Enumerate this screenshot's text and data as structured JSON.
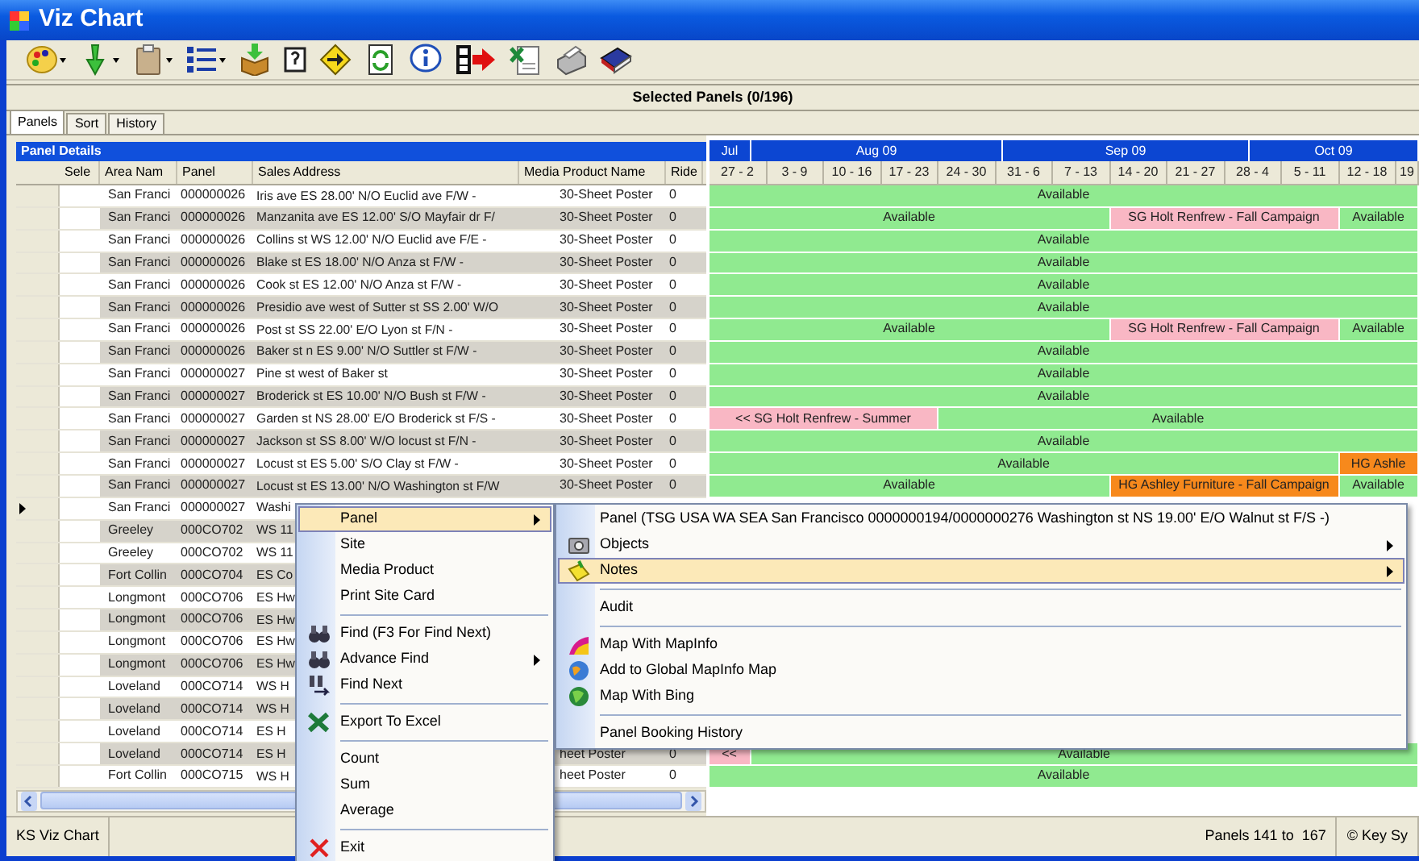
{
  "window": {
    "title": "Viz Chart"
  },
  "toolbar": [
    {
      "kind": "palette",
      "dropdown": true
    },
    {
      "kind": "arrow",
      "dropdown": true
    },
    {
      "kind": "clipboard",
      "dropdown": true
    },
    {
      "kind": "list",
      "dropdown": true
    },
    {
      "kind": "package",
      "dropdown": false
    },
    {
      "kind": "help",
      "dropdown": false
    },
    {
      "kind": "sign",
      "dropdown": false
    },
    {
      "kind": "refresh",
      "dropdown": false
    },
    {
      "kind": "info",
      "dropdown": false
    },
    {
      "kind": "film",
      "dropdown": false
    },
    {
      "kind": "spreadsheet",
      "dropdown": false
    },
    {
      "kind": "printer",
      "dropdown": false
    },
    {
      "kind": "book",
      "dropdown": false
    }
  ],
  "header": {
    "title": "Selected Panels (0/196)"
  },
  "tabs": [
    {
      "label": "Panels",
      "selected": true
    },
    {
      "label": "Sort",
      "selected": false
    },
    {
      "label": "History",
      "selected": false
    }
  ],
  "grid": {
    "title": "Panel Details",
    "columns": [
      "Sele",
      "Area Nam",
      "Panel",
      "Sales Address",
      "Media Product Name",
      "Ride"
    ],
    "rows": [
      {
        "current": false,
        "area": "San Franci",
        "panel": "000000026",
        "address": "Iris ave ES 28.00' N/O Euclid ave F/W -",
        "media": "30-Sheet Poster",
        "ride": "0"
      },
      {
        "current": false,
        "area": "San Franci",
        "panel": "000000026",
        "address": "Manzanita ave ES 12.00' S/O Mayfair dr F/",
        "media": "30-Sheet Poster",
        "ride": "0"
      },
      {
        "current": false,
        "area": "San Franci",
        "panel": "000000026",
        "address": "Collins st WS 12.00' N/O Euclid ave F/E -",
        "media": "30-Sheet Poster",
        "ride": "0"
      },
      {
        "current": false,
        "area": "San Franci",
        "panel": "000000026",
        "address": "Blake st ES 18.00' N/O Anza st F/W -",
        "media": "30-Sheet Poster",
        "ride": "0"
      },
      {
        "current": false,
        "area": "San Franci",
        "panel": "000000026",
        "address": "Cook st ES 12.00' N/O Anza st F/W -",
        "media": "30-Sheet Poster",
        "ride": "0"
      },
      {
        "current": false,
        "area": "San Franci",
        "panel": "000000026",
        "address": "Presidio ave west of Sutter st SS 2.00' W/O",
        "media": "30-Sheet Poster",
        "ride": "0"
      },
      {
        "current": false,
        "area": "San Franci",
        "panel": "000000026",
        "address": "Post st SS 22.00' E/O Lyon st F/N -",
        "media": "30-Sheet Poster",
        "ride": "0"
      },
      {
        "current": false,
        "area": "San Franci",
        "panel": "000000026",
        "address": "Baker st n ES 9.00' N/O Suttler st F/W -",
        "media": "30-Sheet Poster",
        "ride": "0"
      },
      {
        "current": false,
        "area": "San Franci",
        "panel": "000000027",
        "address": "Pine st west of Baker st",
        "media": "30-Sheet Poster",
        "ride": "0"
      },
      {
        "current": false,
        "area": "San Franci",
        "panel": "000000027",
        "address": "Broderick st ES 10.00' N/O Bush st F/W -",
        "media": "30-Sheet Poster",
        "ride": "0"
      },
      {
        "current": false,
        "area": "San Franci",
        "panel": "000000027",
        "address": "Garden st NS 28.00' E/O Broderick st F/S -",
        "media": "30-Sheet Poster",
        "ride": "0"
      },
      {
        "current": false,
        "area": "San Franci",
        "panel": "000000027",
        "address": "Jackson st SS 8.00' W/O locust st F/N -",
        "media": "30-Sheet Poster",
        "ride": "0"
      },
      {
        "current": false,
        "area": "San Franci",
        "panel": "000000027",
        "address": "Locust st ES 5.00' S/O Clay st F/W -",
        "media": "30-Sheet Poster",
        "ride": "0"
      },
      {
        "current": false,
        "area": "San Franci",
        "panel": "000000027",
        "address": "Locust st ES 13.00' N/O Washington st F/W",
        "media": "30-Sheet Poster",
        "ride": "0"
      },
      {
        "current": true,
        "area": "San Franci",
        "panel": "000000027",
        "address": "Washi"
      },
      {
        "current": false,
        "area": "Greeley",
        "panel": "000CO702",
        "address": "WS 11"
      },
      {
        "current": false,
        "area": "Greeley",
        "panel": "000CO702",
        "address": "WS 11"
      },
      {
        "current": false,
        "area": "Fort Collin",
        "panel": "000CO704",
        "address": "ES Co"
      },
      {
        "current": false,
        "area": "Longmont",
        "panel": "000CO706",
        "address": "ES Hw"
      },
      {
        "current": false,
        "area": "Longmont",
        "panel": "000CO706",
        "address": "ES Hw"
      },
      {
        "current": false,
        "area": "Longmont",
        "panel": "000CO706",
        "address": "ES Hw"
      },
      {
        "current": false,
        "area": "Longmont",
        "panel": "000CO706",
        "address": "ES Hw"
      },
      {
        "current": false,
        "area": "Loveland",
        "panel": "000CO714",
        "address": "WS H"
      },
      {
        "current": false,
        "area": "Loveland",
        "panel": "000CO714",
        "address": "WS H"
      },
      {
        "current": false,
        "area": "Loveland",
        "panel": "000CO714",
        "address": "ES H"
      },
      {
        "current": false,
        "area": "Loveland",
        "panel": "000CO714",
        "address": "ES H",
        "media": "heet Poster",
        "ride": "0"
      },
      {
        "current": false,
        "area": "Fort Collin",
        "panel": "000CO715",
        "address": "WS H",
        "media": "heet Poster",
        "ride": "0"
      }
    ]
  },
  "chart": {
    "months": [
      "Jul",
      "Aug 09",
      "Sep 09",
      "Oct 09"
    ],
    "weeks": [
      "27 - 2",
      "3 - 9",
      "10 - 16",
      "17 - 23",
      "24 - 30",
      "31 - 6",
      "7 - 13",
      "14 - 20",
      "21 - 27",
      "28 - 4",
      "5 - 11",
      "12 - 18",
      "19"
    ],
    "rows": [
      {
        "segments": [
          {
            "kind": "available",
            "label": "Available"
          }
        ]
      },
      {
        "segments": [
          {
            "kind": "available",
            "label": "Available"
          },
          {
            "kind": "hold",
            "label": "SG Holt Renfrew - Fall Campaign"
          },
          {
            "kind": "available",
            "label": "Available"
          }
        ]
      },
      {
        "segments": [
          {
            "kind": "available",
            "label": "Available"
          }
        ]
      },
      {
        "segments": [
          {
            "kind": "available",
            "label": "Available"
          }
        ]
      },
      {
        "segments": [
          {
            "kind": "available",
            "label": "Available"
          }
        ]
      },
      {
        "segments": [
          {
            "kind": "available",
            "label": "Available"
          }
        ]
      },
      {
        "segments": [
          {
            "kind": "available",
            "label": "Available"
          },
          {
            "kind": "hold",
            "label": "SG Holt Renfrew - Fall Campaign"
          },
          {
            "kind": "available",
            "label": "Available"
          }
        ]
      },
      {
        "segments": [
          {
            "kind": "available",
            "label": "Available"
          }
        ]
      },
      {
        "segments": [
          {
            "kind": "available",
            "label": "Available"
          }
        ]
      },
      {
        "segments": [
          {
            "kind": "available",
            "label": "Available"
          }
        ]
      },
      {
        "segments": [
          {
            "kind": "hold",
            "label": "<< SG Holt Renfrew - Summer"
          },
          {
            "kind": "available",
            "label": "Available"
          }
        ]
      },
      {
        "segments": [
          {
            "kind": "available",
            "label": "Available"
          }
        ]
      },
      {
        "segments": [
          {
            "kind": "available",
            "label": "Available"
          },
          {
            "kind": "booked",
            "label": "HG Ashle"
          }
        ]
      },
      {
        "segments": [
          {
            "kind": "available",
            "label": "Available"
          },
          {
            "kind": "booked",
            "label": "HG Ashley Furniture - Fall Campaign"
          },
          {
            "kind": "available",
            "label": "Available"
          }
        ]
      }
    ],
    "lower_rows": [
      {
        "segments": [
          {
            "kind": "hold",
            "label": "<<"
          },
          {
            "kind": "available",
            "label": "Available"
          }
        ]
      },
      {
        "segments": [
          {
            "kind": "available",
            "label": "Available"
          }
        ]
      }
    ]
  },
  "context_menu": [
    {
      "kind": "item",
      "label": "Panel",
      "selected": true,
      "submenu": true
    },
    {
      "kind": "item",
      "label": "Site",
      "selected": false,
      "submenu": false
    },
    {
      "kind": "item",
      "label": "Media Product",
      "selected": false,
      "submenu": false
    },
    {
      "kind": "item",
      "label": "Print Site Card",
      "selected": false,
      "submenu": false
    },
    {
      "kind": "separator"
    },
    {
      "kind": "item",
      "label": "Find (F3 For Find Next)",
      "selected": false,
      "submenu": false
    },
    {
      "kind": "item",
      "label": "Advance Find",
      "selected": false,
      "submenu": true
    },
    {
      "kind": "item",
      "label": "Find Next",
      "selected": false,
      "submenu": false
    },
    {
      "kind": "separator"
    },
    {
      "kind": "item",
      "label": "Export To Excel",
      "selected": false,
      "submenu": false
    },
    {
      "kind": "separator"
    },
    {
      "kind": "item",
      "label": "Count",
      "selected": false,
      "submenu": false
    },
    {
      "kind": "item",
      "label": "Sum",
      "selected": false,
      "submenu": false
    },
    {
      "kind": "item",
      "label": "Average",
      "selected": false,
      "submenu": false
    },
    {
      "kind": "separator"
    },
    {
      "kind": "item",
      "label": "Exit",
      "selected": false,
      "submenu": false
    }
  ],
  "submenu": [
    {
      "kind": "item",
      "label": "Panel (TSG USA WA SEA San Francisco 0000000194/0000000276 Washington st NS 19.00' E/O Walnut st F/S -)",
      "selected": false,
      "submenu": false
    },
    {
      "kind": "item",
      "label": "Objects",
      "selected": false,
      "submenu": true
    },
    {
      "kind": "item",
      "label": "Notes",
      "selected": true,
      "submenu": true
    },
    {
      "kind": "separator"
    },
    {
      "kind": "item",
      "label": "Audit",
      "selected": false,
      "submenu": false
    },
    {
      "kind": "separator"
    },
    {
      "kind": "item",
      "label": "Map With MapInfo",
      "selected": false,
      "submenu": false
    },
    {
      "kind": "item",
      "label": "Add to Global MapInfo Map",
      "selected": false,
      "submenu": false
    },
    {
      "kind": "item",
      "label": "Map With Bing",
      "selected": false,
      "submenu": false
    },
    {
      "kind": "separator"
    },
    {
      "kind": "item",
      "label": "Panel Booking History",
      "selected": false,
      "submenu": false
    }
  ],
  "status_bar": [
    "KS Viz Chart",
    "Panels 141 to  167",
    "© Key Sy"
  ]
}
